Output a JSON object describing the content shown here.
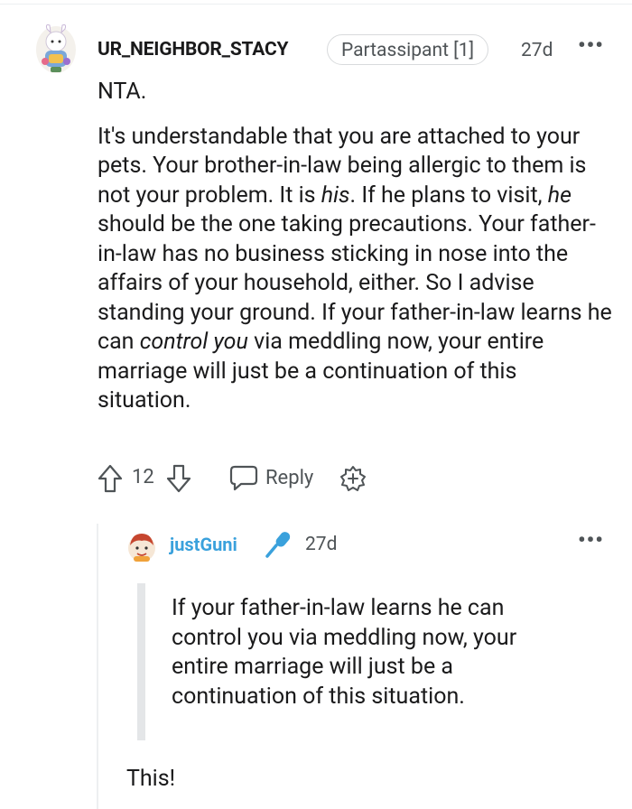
{
  "comment": {
    "username": "UR_NEIGHBOR_STACY",
    "flair": "Partassipant [1]",
    "time": "27d",
    "more": "•••",
    "verdict": "NTA.",
    "body": [
      {
        "text": "It's understandable that you are attached to your pets. Your brother-in-law being allergic to them is not your problem. It is "
      },
      {
        "text": "his",
        "em": true
      },
      {
        "text": ". If he plans to visit, "
      },
      {
        "text": "he",
        "em": true
      },
      {
        "text": " should be the one taking precautions. Your father-in-law has no business sticking in nose into the affairs of your household, either. So I advise standing your ground. If your father-in-law learns he can "
      },
      {
        "text": "control you",
        "em": true
      },
      {
        "text": " via meddling now, your entire marriage will just be a continuation of this situation."
      }
    ],
    "actions": {
      "vote_count": "12",
      "reply_label": "Reply"
    }
  },
  "reply": {
    "username": "justGuni",
    "time": "27d",
    "more": "•••",
    "quote": "If your father-in-law learns he can control you via meddling now, your entire marriage will just be a continuation of this situation.",
    "text": "This!"
  },
  "colors": {
    "username_reply": "#3aa1dc",
    "meta_text": "#4f5457",
    "quote_bar": "#e4e6e8"
  }
}
